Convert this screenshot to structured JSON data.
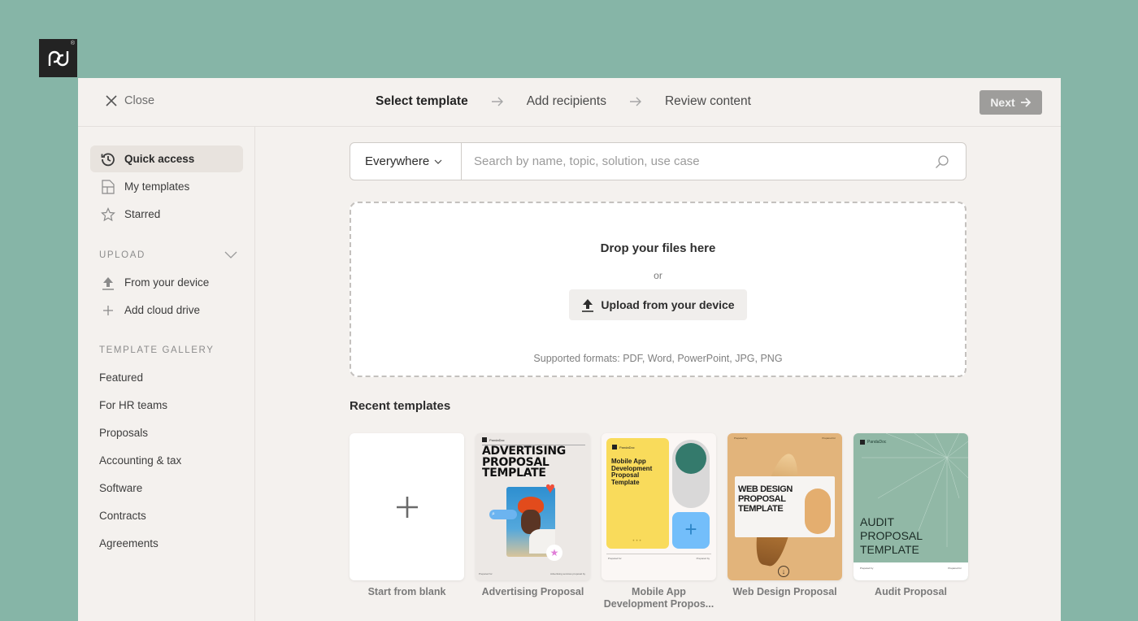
{
  "brand": {
    "logo_text": "pd",
    "registered_mark": "®"
  },
  "header": {
    "close_label": "Close",
    "steps": [
      {
        "label": "Select template",
        "active": true
      },
      {
        "label": "Add recipients",
        "active": false
      },
      {
        "label": "Review content",
        "active": false
      }
    ],
    "next_label": "Next"
  },
  "sidebar": {
    "primary": [
      {
        "label": "Quick access",
        "icon": "history-icon",
        "active": true
      },
      {
        "label": "My templates",
        "icon": "template-icon",
        "active": false
      },
      {
        "label": "Starred",
        "icon": "star-icon",
        "active": false
      }
    ],
    "upload_section": {
      "label": "UPLOAD",
      "items": [
        {
          "label": "From your device",
          "icon": "upload-icon"
        },
        {
          "label": "Add cloud drive",
          "icon": "plus-icon"
        }
      ]
    },
    "gallery_section": {
      "label": "TEMPLATE GALLERY",
      "items": [
        "Featured",
        "For HR teams",
        "Proposals",
        "Accounting & tax",
        "Software",
        "Contracts",
        "Agreements"
      ]
    }
  },
  "search": {
    "scope_value": "Everywhere",
    "placeholder": "Search by name, topic, solution, use case",
    "value": ""
  },
  "dropzone": {
    "title": "Drop your files here",
    "or_text": "or",
    "button_label": "Upload from your device",
    "formats_text": "Supported formats: PDF, Word, PowerPoint, JPG, PNG"
  },
  "recent": {
    "title": "Recent templates",
    "cards": [
      {
        "label": "Start from blank",
        "thumb": "blank"
      },
      {
        "label": "Advertising Proposal",
        "thumb": "advertising",
        "thumb_title": "ADVERTISING PROPOSAL TEMPLATE",
        "thumb_brand": "PandaDoc"
      },
      {
        "label": "Mobile App Development Propos...",
        "thumb": "mobile",
        "thumb_title": "Mobile App Development Proposal Template",
        "thumb_brand": "PandaDoc"
      },
      {
        "label": "Web Design Proposal",
        "thumb": "web",
        "thumb_title": "WEB DESIGN PROPOSAL TEMPLATE"
      },
      {
        "label": "Audit Proposal",
        "thumb": "audit",
        "thumb_title": "AUDIT PROPOSAL TEMPLATE",
        "thumb_brand": "PandaDoc"
      }
    ]
  },
  "colors": {
    "background": "#86b5a7",
    "panel": "#f4f1ee",
    "next_button": "#9e9d9b",
    "active_nav": "#e8e3de"
  }
}
